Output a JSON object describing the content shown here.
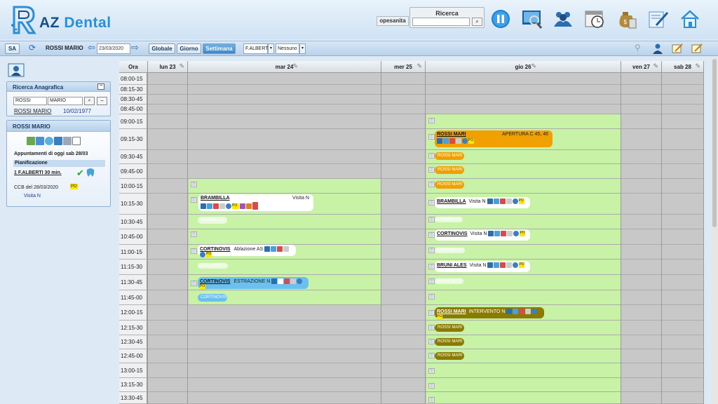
{
  "app": {
    "logo_prefix": "AZ",
    "logo_suffix": "Dental"
  },
  "topbar": {
    "operator": "opesanita",
    "search_title": "Ricerca",
    "search_value": "",
    "search_go": "⌕",
    "icons": [
      "pause-icon",
      "monitor-search-icon",
      "users-icon",
      "calendar-clock-icon",
      "money-bag-icon",
      "pen-paper-icon",
      "home-icon"
    ]
  },
  "subbar": {
    "location": "SA",
    "patient": "ROSSI MARIO",
    "date": "23/03/2020",
    "btn_globale": "Globale",
    "btn_giorno": "Giorno",
    "btn_settimana": "Settimana",
    "doctor": "F.ALBERTI",
    "filter": "Nessuno"
  },
  "sidebar": {
    "search_panel": {
      "title": "Ricerca Anagrafica",
      "surname": "ROSSI",
      "name": "MARIO",
      "result_name": "ROSSI MARIO",
      "result_date": "10/02/1977"
    },
    "patient_panel": {
      "title": "ROSSI MARIO",
      "today_label": "Appuntamenti di oggi sab 28/03",
      "planning_label": "Pianificazione",
      "plan_item": "1 F.ALBERTI 30 min.",
      "ccb": "CCB del 28/03/2020",
      "po": "PO",
      "visit": "Visita N"
    }
  },
  "calendar": {
    "ora_label": "Ora",
    "days": [
      "lun 23",
      "mar 24",
      "mer 25",
      "gio 26",
      "ven 27",
      "sab 28"
    ],
    "times": [
      "08:00-15",
      "08:15-30",
      "08:30-45",
      "08:45-00",
      "09:00-15",
      "09:15-30",
      "09:30-45",
      "09:45-00",
      "10:00-15",
      "10:15-30",
      "10:30-45",
      "10:45-00",
      "11:00-15",
      "11:15-30",
      "11:30-45",
      "11:45-00",
      "12:00-15",
      "12:15-30",
      "12:30-45",
      "12:45-00",
      "13:00-15",
      "13:15-30",
      "13:30-45"
    ],
    "appointments": [
      {
        "name": "BRAMBILLA",
        "desc": "Visita N",
        "po": "PO"
      },
      {
        "name": "CORTINOVIS",
        "desc": "Ablazione AS",
        "po": "PO"
      },
      {
        "name": "CORTINOVIS",
        "desc": "ESTRAZIONE N",
        "po": "PO"
      },
      {
        "name": "ROSSI MARI",
        "desc": "APERTURA C 45, 46",
        "po": "PO"
      },
      {
        "name": "BRAMBILLA",
        "desc": "Visita N",
        "po": "PO"
      },
      {
        "name": "CORTINOVIS",
        "desc": "Visita N",
        "po": "PO"
      },
      {
        "name": "BRUNI ALES",
        "desc": "Visita N",
        "po": "PO"
      },
      {
        "name": "ROSSI MARI",
        "desc": "INTERVENTO N",
        "po": "PO"
      }
    ],
    "ghosts": {
      "brambilla": "BRAMBILLA",
      "cortinovis": "CORTINOVIS",
      "bruni": "BRUNI ALES",
      "rossi": "ROSSI MARI"
    }
  },
  "colors": {
    "slot_green": "#c8f3a6",
    "orange": "#f0a000",
    "olive": "#8a7a00",
    "blue": "#6cc0f0"
  }
}
